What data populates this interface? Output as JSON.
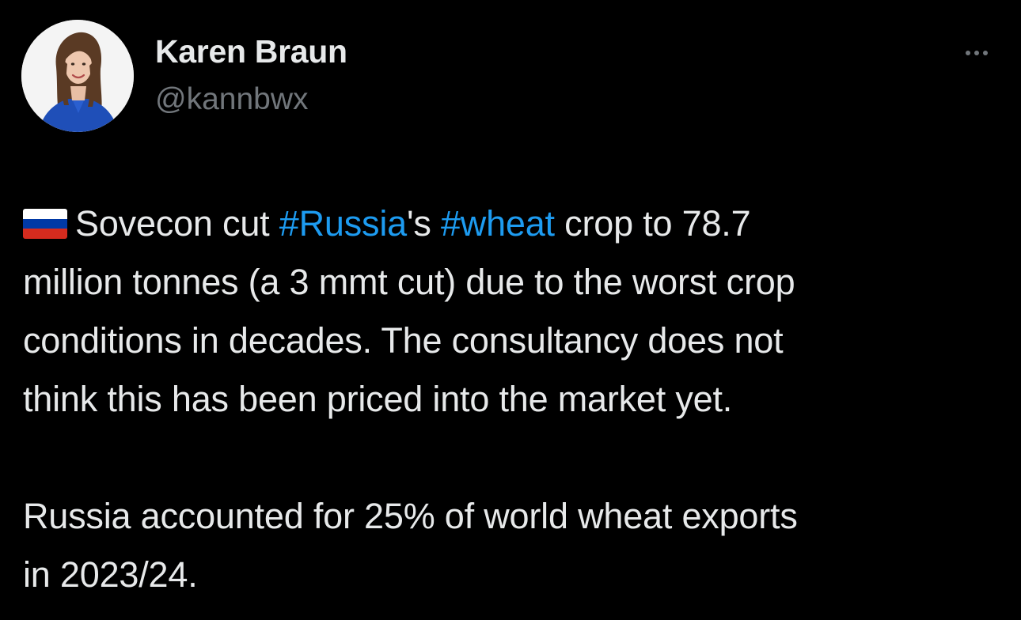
{
  "author": {
    "display_name": "Karen Braun",
    "handle": "@kannbwx",
    "avatar_icon": "profile-photo"
  },
  "more_icon": "more-horizontal-icon",
  "tweet": {
    "flag_icon": "russia-flag-emoji",
    "paragraph1": {
      "line1_t1": "Sovecon cut ",
      "hashtag1": "#Russia",
      "line1_t2": "'s ",
      "hashtag2": "#wheat",
      "line1_t3": " crop to 78.7",
      "line2": "million tonnes (a 3 mmt cut) due to the worst crop",
      "line3": "conditions in decades. The consultancy does not",
      "line4": "think this has been priced into the market yet."
    },
    "paragraph2": {
      "line1": "Russia accounted for 25% of world wheat exports",
      "line2": "in 2023/24."
    }
  },
  "colors": {
    "background": "#000000",
    "text_primary": "#e7e9ea",
    "text_secondary": "#71767b",
    "link": "#1d9bf0",
    "flag_white": "#ffffff",
    "flag_blue": "#0039a6",
    "flag_red": "#d52b1e"
  }
}
